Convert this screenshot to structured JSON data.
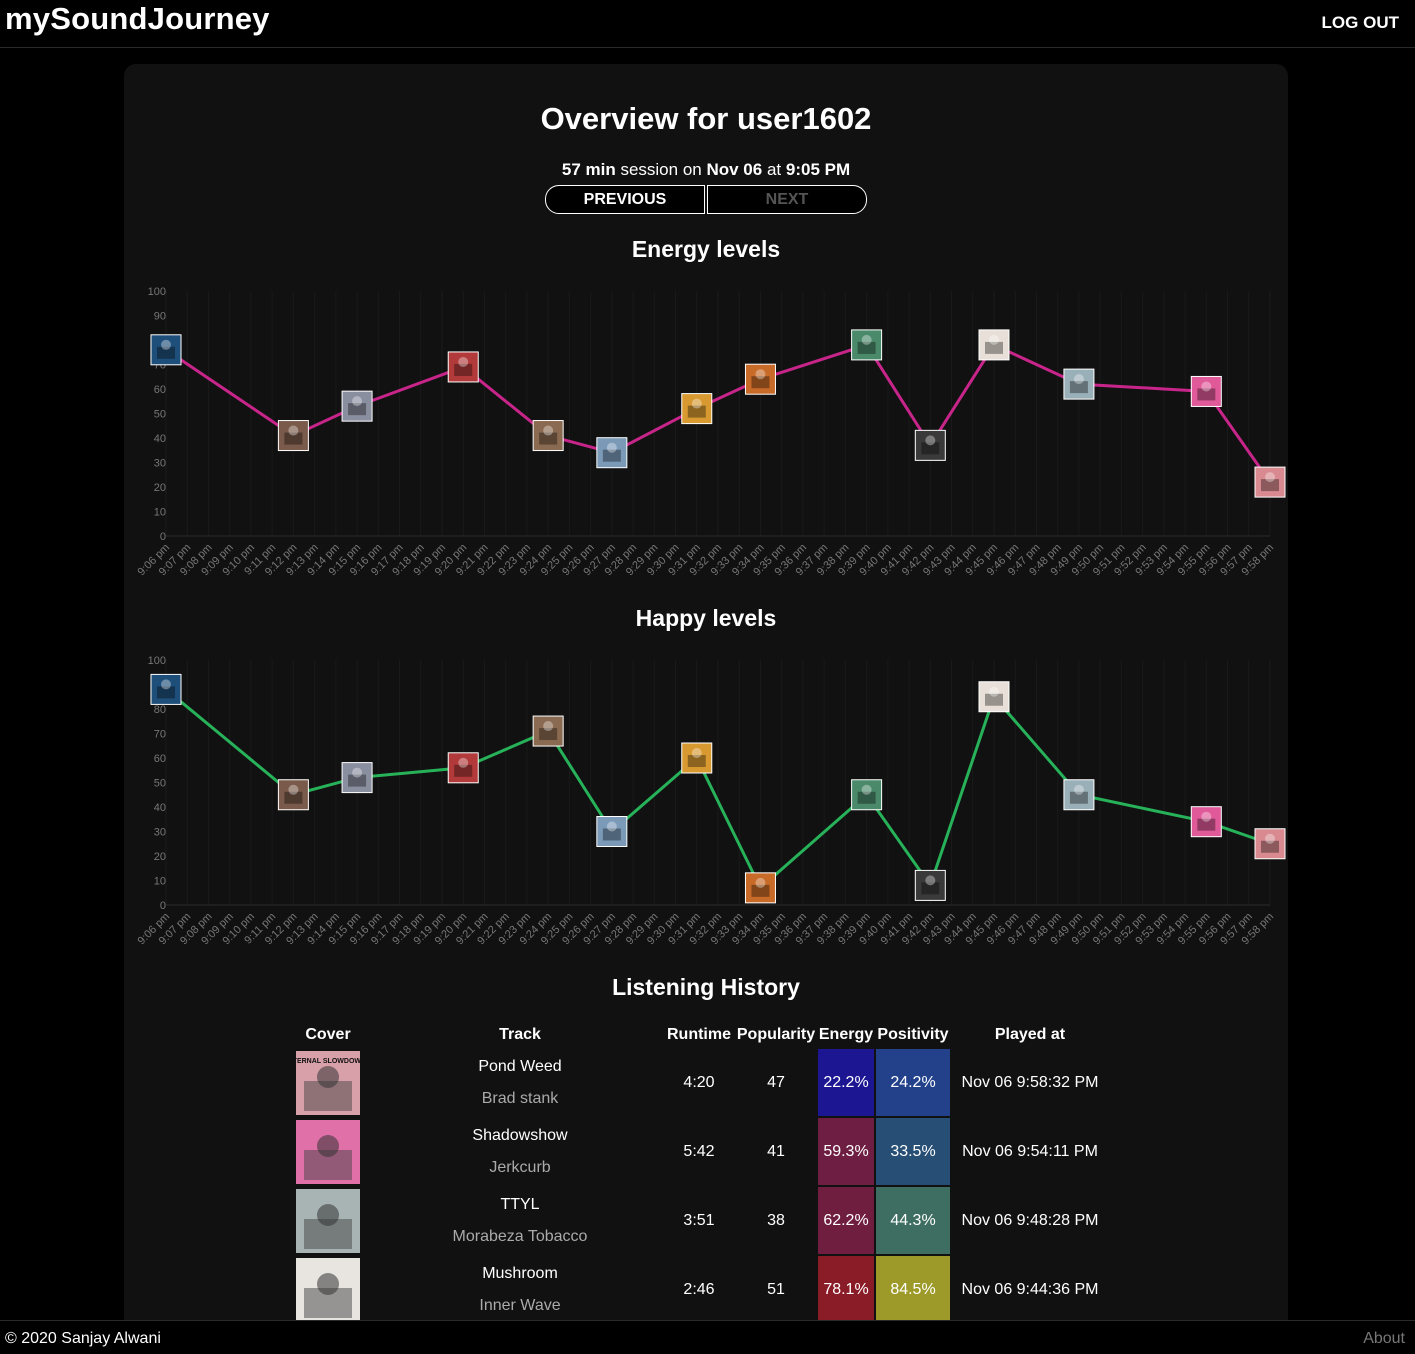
{
  "header": {
    "brand": "mySoundJourney",
    "logout_label": "LOG OUT"
  },
  "overview": {
    "title": "Overview for user1602",
    "session_minutes": "57 min",
    "session_word": "session on",
    "session_date": "Nov 06",
    "session_at": "at",
    "session_time": "9:05 PM",
    "previous_label": "PREVIOUS",
    "next_label": "NEXT"
  },
  "energy_chart": {
    "title": "Energy levels"
  },
  "happy_chart": {
    "title": "Happy levels"
  },
  "chart_data": [
    {
      "type": "line",
      "title": "Energy levels",
      "x": [
        "9:06 pm",
        "9:07 pm",
        "9:08 pm",
        "9:09 pm",
        "9:10 pm",
        "9:11 pm",
        "9:12 pm",
        "9:13 pm",
        "9:14 pm",
        "9:15 pm",
        "9:16 pm",
        "9:17 pm",
        "9:18 pm",
        "9:19 pm",
        "9:20 pm",
        "9:21 pm",
        "9:22 pm",
        "9:23 pm",
        "9:24 pm",
        "9:25 pm",
        "9:26 pm",
        "9:27 pm",
        "9:28 pm",
        "9:29 pm",
        "9:30 pm",
        "9:31 pm",
        "9:32 pm",
        "9:33 pm",
        "9:34 pm",
        "9:35 pm",
        "9:36 pm",
        "9:37 pm",
        "9:38 pm",
        "9:39 pm",
        "9:40 pm",
        "9:41 pm",
        "9:42 pm",
        "9:43 pm",
        "9:44 pm",
        "9:45 pm",
        "9:46 pm",
        "9:47 pm",
        "9:48 pm",
        "9:49 pm",
        "9:50 pm",
        "9:51 pm",
        "9:52 pm",
        "9:53 pm",
        "9:54 pm",
        "9:55 pm",
        "9:56 pm",
        "9:57 pm",
        "9:58 pm"
      ],
      "ylim": [
        0,
        100
      ],
      "yticks": [
        0,
        10,
        20,
        30,
        40,
        50,
        60,
        70,
        80,
        90,
        100
      ],
      "color": "#c8258a",
      "points": [
        {
          "x": "9:06 pm",
          "y": 76,
          "art": "#1e4f7a"
        },
        {
          "x": "9:12 pm",
          "y": 41,
          "art": "#7a5a4a"
        },
        {
          "x": "9:15 pm",
          "y": 53,
          "art": "#8a8fa0"
        },
        {
          "x": "9:20 pm",
          "y": 69,
          "art": "#b23a3a"
        },
        {
          "x": "9:24 pm",
          "y": 41,
          "art": "#8a6a50"
        },
        {
          "x": "9:27 pm",
          "y": 34,
          "art": "#7a9ab8"
        },
        {
          "x": "9:31 pm",
          "y": 52,
          "art": "#d89a30"
        },
        {
          "x": "9:34 pm",
          "y": 64,
          "art": "#c86a28"
        },
        {
          "x": "9:39 pm",
          "y": 78,
          "art": "#4a8a6a"
        },
        {
          "x": "9:42 pm",
          "y": 37,
          "art": "#3a3a3a"
        },
        {
          "x": "9:45 pm",
          "y": 78,
          "art": "#e8e0d8"
        },
        {
          "x": "9:49 pm",
          "y": 62,
          "art": "#9ab0b8"
        },
        {
          "x": "9:55 pm",
          "y": 59,
          "art": "#e05a9a"
        },
        {
          "x": "9:58 pm",
          "y": 22,
          "art": "#d88a90"
        }
      ]
    },
    {
      "type": "line",
      "title": "Happy levels",
      "x": [
        "9:06 pm",
        "9:07 pm",
        "9:08 pm",
        "9:09 pm",
        "9:10 pm",
        "9:11 pm",
        "9:12 pm",
        "9:13 pm",
        "9:14 pm",
        "9:15 pm",
        "9:16 pm",
        "9:17 pm",
        "9:18 pm",
        "9:19 pm",
        "9:20 pm",
        "9:21 pm",
        "9:22 pm",
        "9:23 pm",
        "9:24 pm",
        "9:25 pm",
        "9:26 pm",
        "9:27 pm",
        "9:28 pm",
        "9:29 pm",
        "9:30 pm",
        "9:31 pm",
        "9:32 pm",
        "9:33 pm",
        "9:34 pm",
        "9:35 pm",
        "9:36 pm",
        "9:37 pm",
        "9:38 pm",
        "9:39 pm",
        "9:40 pm",
        "9:41 pm",
        "9:42 pm",
        "9:43 pm",
        "9:44 pm",
        "9:45 pm",
        "9:46 pm",
        "9:47 pm",
        "9:48 pm",
        "9:49 pm",
        "9:50 pm",
        "9:51 pm",
        "9:52 pm",
        "9:53 pm",
        "9:54 pm",
        "9:55 pm",
        "9:56 pm",
        "9:57 pm",
        "9:58 pm"
      ],
      "ylim": [
        0,
        100
      ],
      "yticks": [
        0,
        10,
        20,
        30,
        40,
        50,
        60,
        70,
        80,
        90,
        100
      ],
      "color": "#27b25a",
      "points": [
        {
          "x": "9:06 pm",
          "y": 88,
          "art": "#1e4f7a"
        },
        {
          "x": "9:12 pm",
          "y": 45,
          "art": "#7a5a4a"
        },
        {
          "x": "9:15 pm",
          "y": 52,
          "art": "#8a8fa0"
        },
        {
          "x": "9:20 pm",
          "y": 56,
          "art": "#b23a3a"
        },
        {
          "x": "9:24 pm",
          "y": 71,
          "art": "#8a6a50"
        },
        {
          "x": "9:27 pm",
          "y": 30,
          "art": "#7a9ab8"
        },
        {
          "x": "9:31 pm",
          "y": 60,
          "art": "#d89a30"
        },
        {
          "x": "9:34 pm",
          "y": 7,
          "art": "#c86a28"
        },
        {
          "x": "9:39 pm",
          "y": 45,
          "art": "#4a8a6a"
        },
        {
          "x": "9:42 pm",
          "y": 8,
          "art": "#3a3a3a"
        },
        {
          "x": "9:45 pm",
          "y": 85,
          "art": "#e8e0d8"
        },
        {
          "x": "9:49 pm",
          "y": 45,
          "art": "#9ab0b8"
        },
        {
          "x": "9:55 pm",
          "y": 34,
          "art": "#e05a9a"
        },
        {
          "x": "9:58 pm",
          "y": 25,
          "art": "#d88a90"
        }
      ]
    }
  ],
  "history": {
    "title": "Listening History",
    "columns": [
      "Cover",
      "Track",
      "Runtime",
      "Popularity",
      "Energy",
      "Positivity",
      "Played at"
    ],
    "rows": [
      {
        "cover_color": "#d8a0a8",
        "cover_text": "ETERNAL SLOWDOWN.",
        "name": "Pond Weed",
        "artist": "Brad stank",
        "runtime": "4:20",
        "popularity": "47",
        "energy": "22.2%",
        "energy_color": "#1c1692",
        "positivity": "24.2%",
        "positivity_color": "#22418a",
        "played": "Nov 06 9:58:32 PM"
      },
      {
        "cover_color": "#e070a8",
        "cover_text": "",
        "name": "Shadowshow",
        "artist": "Jerkcurb",
        "runtime": "5:42",
        "popularity": "41",
        "energy": "59.3%",
        "energy_color": "#6e1e42",
        "positivity": "33.5%",
        "positivity_color": "#274e74",
        "played": "Nov 06 9:54:11 PM"
      },
      {
        "cover_color": "#a8b4b4",
        "cover_text": "",
        "name": "TTYL",
        "artist": "Morabeza Tobacco",
        "runtime": "3:51",
        "popularity": "38",
        "energy": "62.2%",
        "energy_color": "#701e40",
        "positivity": "44.3%",
        "positivity_color": "#3e6e62",
        "played": "Nov 06 9:48:28 PM"
      },
      {
        "cover_color": "#e8e4e0",
        "cover_text": "",
        "name": "Mushroom",
        "artist": "Inner Wave",
        "runtime": "2:46",
        "popularity": "51",
        "energy": "78.1%",
        "energy_color": "#8a1c28",
        "positivity": "84.5%",
        "positivity_color": "#9e9a2a",
        "played": "Nov 06 9:44:36 PM"
      }
    ]
  },
  "footer": {
    "copyright": "© 2020 Sanjay Alwani",
    "about_label": "About"
  }
}
